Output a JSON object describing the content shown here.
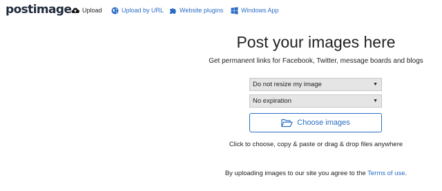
{
  "brand": {
    "logo_text": "postimage"
  },
  "nav": {
    "items": [
      {
        "label": "Upload",
        "icon": "cloud-upload-icon"
      },
      {
        "label": "Upload by URL",
        "icon": "globe-icon"
      },
      {
        "label": "Website plugins",
        "icon": "puzzle-icon"
      },
      {
        "label": "Windows App",
        "icon": "windows-icon"
      }
    ]
  },
  "main": {
    "title": "Post your images here",
    "subtitle": "Get permanent links for Facebook, Twitter, message boards and blogs",
    "resize_select": {
      "value": "Do not resize my image"
    },
    "expiration_select": {
      "value": "No expiration"
    },
    "choose_button": {
      "label": "Choose images",
      "icon": "folder-open-icon"
    },
    "hint": "Click to choose, copy & paste or drag & drop files anywhere",
    "terms": {
      "prefix": "By uploading images to our site you agree to the ",
      "link": "Terms of use",
      "suffix": "."
    }
  },
  "colors": {
    "link": "#2a6cc5",
    "logo": "#1f2a3a",
    "select_bg": "#e5e5e5"
  }
}
